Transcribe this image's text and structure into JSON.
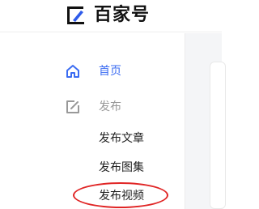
{
  "header": {
    "logo_text": "百家号"
  },
  "sidebar": {
    "items": [
      {
        "label": "首页",
        "icon": "home-icon",
        "state": "active"
      },
      {
        "label": "发布",
        "icon": "edit-icon",
        "state": "group"
      }
    ],
    "publish_sub_items": [
      {
        "label": "发布文章"
      },
      {
        "label": "发布图集"
      },
      {
        "label": "发布视频"
      }
    ]
  },
  "colors": {
    "accent": "#3b6cf2",
    "muted": "#999999",
    "highlight": "#e02525"
  }
}
